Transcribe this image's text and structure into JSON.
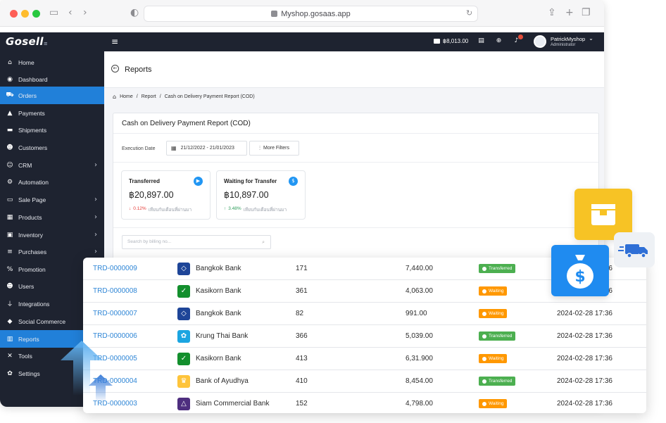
{
  "browser": {
    "url": "Myshop.gosaas.app"
  },
  "logo": {
    "text": "Gosell",
    "sub": "≡"
  },
  "sidebar": {
    "items": [
      {
        "label": "Home",
        "icon": "home-icon"
      },
      {
        "label": "Dashboard",
        "icon": "dashboard-icon"
      },
      {
        "label": "Orders",
        "icon": "cart-icon",
        "active": true
      },
      {
        "label": "Payments",
        "icon": "payments-icon"
      },
      {
        "label": "Shipments",
        "icon": "truck-icon"
      },
      {
        "label": "Customers",
        "icon": "customers-icon"
      },
      {
        "label": "CRM",
        "icon": "crm-icon",
        "chevron": true
      },
      {
        "label": "Automation",
        "icon": "automation-icon"
      },
      {
        "label": "Sale Page",
        "icon": "sale-page-icon",
        "chevron": true
      },
      {
        "label": "Products",
        "icon": "products-icon",
        "chevron": true
      },
      {
        "label": "Inventory",
        "icon": "inventory-icon",
        "chevron": true
      },
      {
        "label": "Purchases",
        "icon": "purchases-icon",
        "chevron": true
      },
      {
        "label": "Promotion",
        "icon": "percent-icon"
      },
      {
        "label": "Users",
        "icon": "users-icon"
      },
      {
        "label": "Integrations",
        "icon": "plug-icon"
      },
      {
        "label": "Social Commerce",
        "icon": "social-icon"
      },
      {
        "label": "Reports",
        "icon": "reports-icon",
        "active": true
      },
      {
        "label": "Tools",
        "icon": "tools-icon"
      },
      {
        "label": "Settings",
        "icon": "gear-icon"
      }
    ]
  },
  "appbar": {
    "balance": "฿8,013.00",
    "user_name": "PatrickMyshop",
    "user_role": "Administrator"
  },
  "page": {
    "title": "Reports",
    "breadcrumb": [
      "Home",
      "Report",
      "Cash on Delivery Payment Report (COD)"
    ]
  },
  "report": {
    "title": "Cash on Delivery Payment Report (COD)",
    "filter_label": "Execution Date",
    "date_range": "21/12/2022 - 21/01/2023",
    "more_filters": "More Filters",
    "search_placeholder": "Search by billing no...",
    "stats": [
      {
        "label": "Transferred",
        "value": "฿20,897.00",
        "change": "0.12%",
        "direction": "down",
        "compare": "เทียบกับเดือนที่ผ่านมา"
      },
      {
        "label": "Waiting for Transfer",
        "value": "฿10,897.00",
        "change": "3.48%",
        "direction": "up",
        "compare": "เทียบกับเดือนที่ผ่านมา"
      }
    ]
  },
  "table": {
    "rows": [
      {
        "id": "TRD-0000009",
        "bank": "Bangkok Bank",
        "bank_color": "#1e4598",
        "qty": "171",
        "amount": "7,440.00",
        "status": "Transferred",
        "date": "2024-02-28 17:36"
      },
      {
        "id": "TRD-0000008",
        "bank": "Kasikorn Bank",
        "bank_color": "#138f2d",
        "qty": "361",
        "amount": "4,063.00",
        "status": "Waiting",
        "date": "2024-02-28 17:36"
      },
      {
        "id": "TRD-0000007",
        "bank": "Bangkok Bank",
        "bank_color": "#1e4598",
        "qty": "82",
        "amount": "991.00",
        "status": "Waiting",
        "date": "2024-02-28 17:36"
      },
      {
        "id": "TRD-0000006",
        "bank": "Krung Thai Bank",
        "bank_color": "#1ba5e1",
        "qty": "366",
        "amount": "5,039.00",
        "status": "Transferred",
        "date": "2024-02-28 17:36"
      },
      {
        "id": "TRD-0000005",
        "bank": "Kasikorn Bank",
        "bank_color": "#138f2d",
        "qty": "413",
        "amount": "6,31.900",
        "status": "Waiting",
        "date": "2024-02-28 17:36"
      },
      {
        "id": "TRD-0000004",
        "bank": "Bank of Ayudhya",
        "bank_color": "#fec43b",
        "qty": "410",
        "amount": "8,454.00",
        "status": "Transferred",
        "date": "2024-02-28 17:36"
      },
      {
        "id": "TRD-0000003",
        "bank": "Siam Commercial Bank",
        "bank_color": "#4e2e7f",
        "qty": "152",
        "amount": "4,798.00",
        "status": "Waiting",
        "date": "2024-02-28 17:36"
      }
    ]
  },
  "colors": {
    "sidebar_bg": "#1e2330",
    "accent": "#2180d9",
    "transferred": "#4caf50",
    "waiting": "#ff9800"
  }
}
